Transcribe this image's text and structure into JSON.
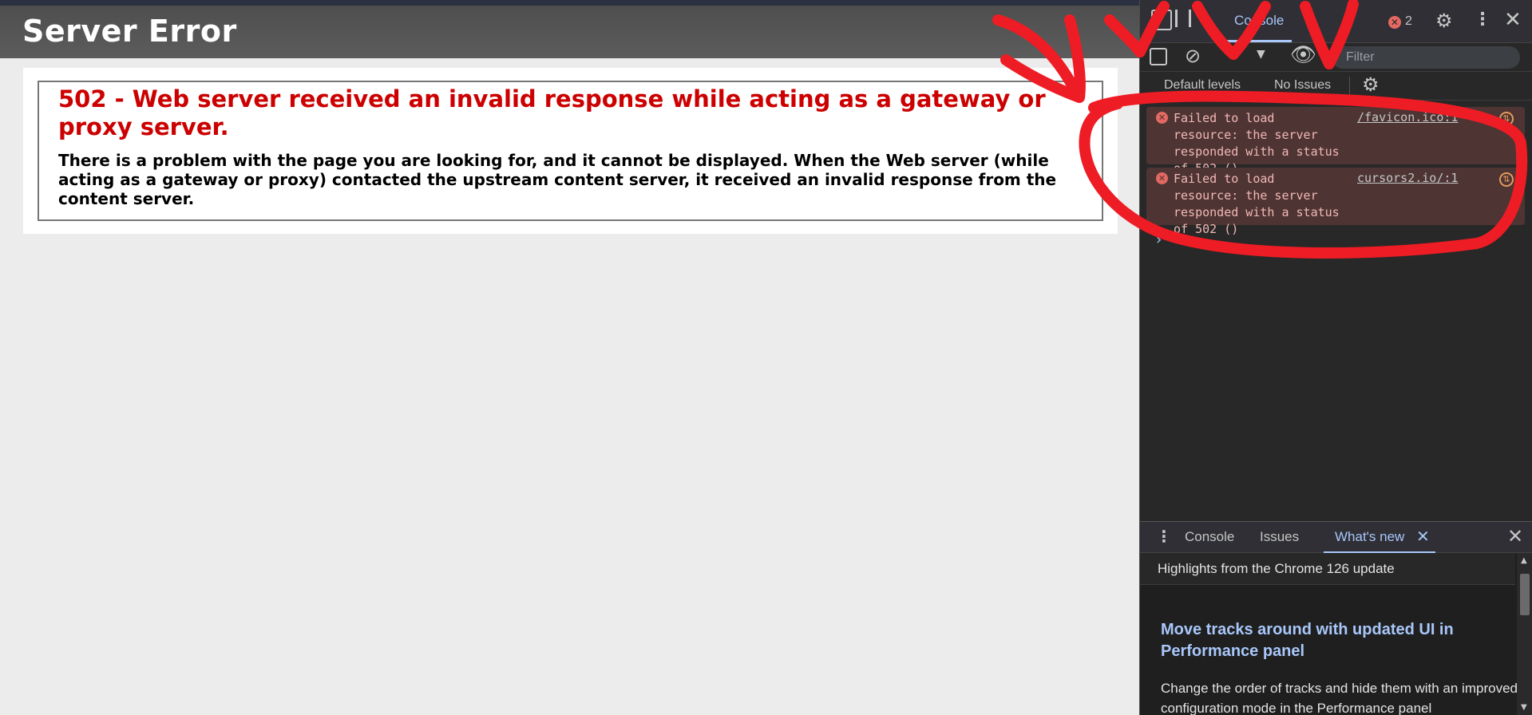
{
  "page": {
    "header_title": "Server Error",
    "error_title": "502 - Web server received an invalid response while acting as a gateway or proxy server.",
    "error_description": "There is a problem with the page you are looking for, and it cannot be displayed. When the Web server (while acting as a gateway or proxy) contacted the upstream content server, it received an invalid response from the content server."
  },
  "devtools": {
    "tabs": {
      "console_label": "Console",
      "error_count": "2"
    },
    "toolbar": {
      "filter_placeholder": "Filter",
      "levels_label": "Default levels",
      "issues_label": "No Issues"
    },
    "messages": [
      {
        "text": "Failed to load\nresource: the server\nresponded with a status of 502 ()",
        "source": "/favicon.ico:1"
      },
      {
        "text": "Failed to load\nresource: the server\nresponded with a status of 502 ()",
        "source": "cursors2.io/:1"
      }
    ],
    "drawer": {
      "tabs": [
        "Console",
        "Issues",
        "What's new"
      ],
      "highlights": "Highlights from the Chrome 126 update",
      "feature_title": "Move tracks around with updated UI in Performance panel",
      "feature_desc": "Change the order of tracks and hide them with an improved configuration mode in the Performance panel"
    }
  },
  "colors": {
    "error_red": "#cc0000",
    "annotation_red": "#ee1c24",
    "devtools_accent": "#a8c7fa",
    "message_bg": "#4e3534"
  },
  "icons": [
    "inspect-icon",
    "settings-icon",
    "more-icon",
    "close-icon",
    "sidebar-icon",
    "clear-icon",
    "eye-icon",
    "error-icon",
    "network-icon",
    "chevron-right-icon",
    "scroll-arrow-icon"
  ]
}
